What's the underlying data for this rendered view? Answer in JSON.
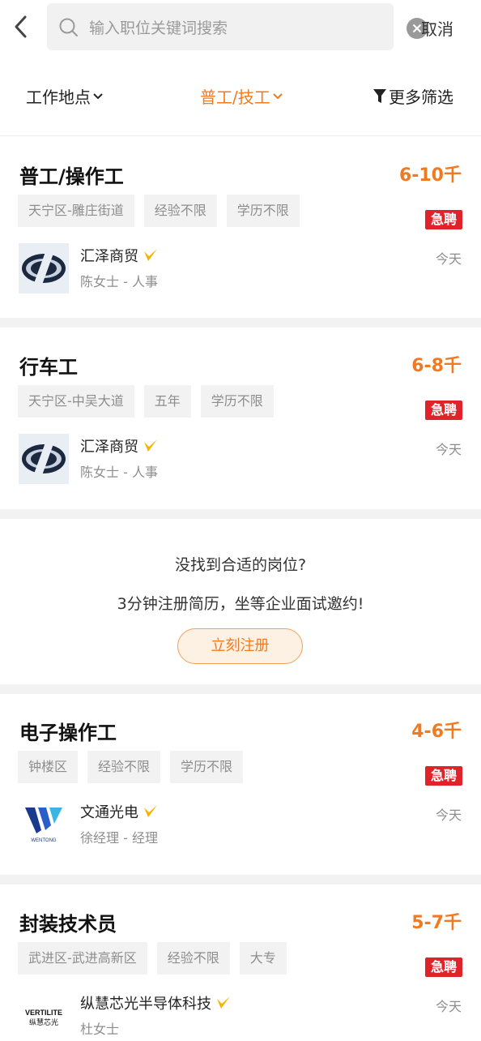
{
  "search": {
    "placeholder": "输入职位关键词搜索",
    "cancel_label": "取消"
  },
  "filters": {
    "location": "工作地点",
    "category": "普工/技工",
    "more": "更多筛选"
  },
  "jobs": [
    {
      "title": "普工/操作工",
      "salary": "6-10千",
      "tags": [
        "天宁区-雕庄街道",
        "经验不限",
        "学历不限"
      ],
      "urgent": "急聘",
      "company": "汇泽商贸",
      "contact": "陈女士 - 人事",
      "time": "今天"
    },
    {
      "title": "行车工",
      "salary": "6-8千",
      "tags": [
        "天宁区-中吴大道",
        "五年",
        "学历不限"
      ],
      "urgent": "急聘",
      "company": "汇泽商贸",
      "contact": "陈女士 - 人事",
      "time": "今天"
    },
    {
      "title": "电子操作工",
      "salary": "4-6千",
      "tags": [
        "钟楼区",
        "经验不限",
        "学历不限"
      ],
      "urgent": "急聘",
      "company": "文通光电",
      "contact": "徐经理 - 经理",
      "time": "今天"
    },
    {
      "title": "封装技术员",
      "salary": "5-7千",
      "tags": [
        "武进区-武进高新区",
        "经验不限",
        "大专"
      ],
      "urgent": "急聘",
      "company": "纵慧芯光半导体科技",
      "contact": "杜女士",
      "time": "今天"
    }
  ],
  "promo": {
    "question": "没找到合适的岗位?",
    "subtitle": "3分钟注册简历，坐等企业面试邀约!",
    "button": "立刻注册"
  },
  "logos": {
    "wentong_text": "WENTONG",
    "vertilite_text": "VERTILITE",
    "vertilite_cn": "纵慧芯光"
  },
  "colors": {
    "accent": "#f07a22",
    "urgent": "#e0222b",
    "verified": "#f5b400"
  }
}
